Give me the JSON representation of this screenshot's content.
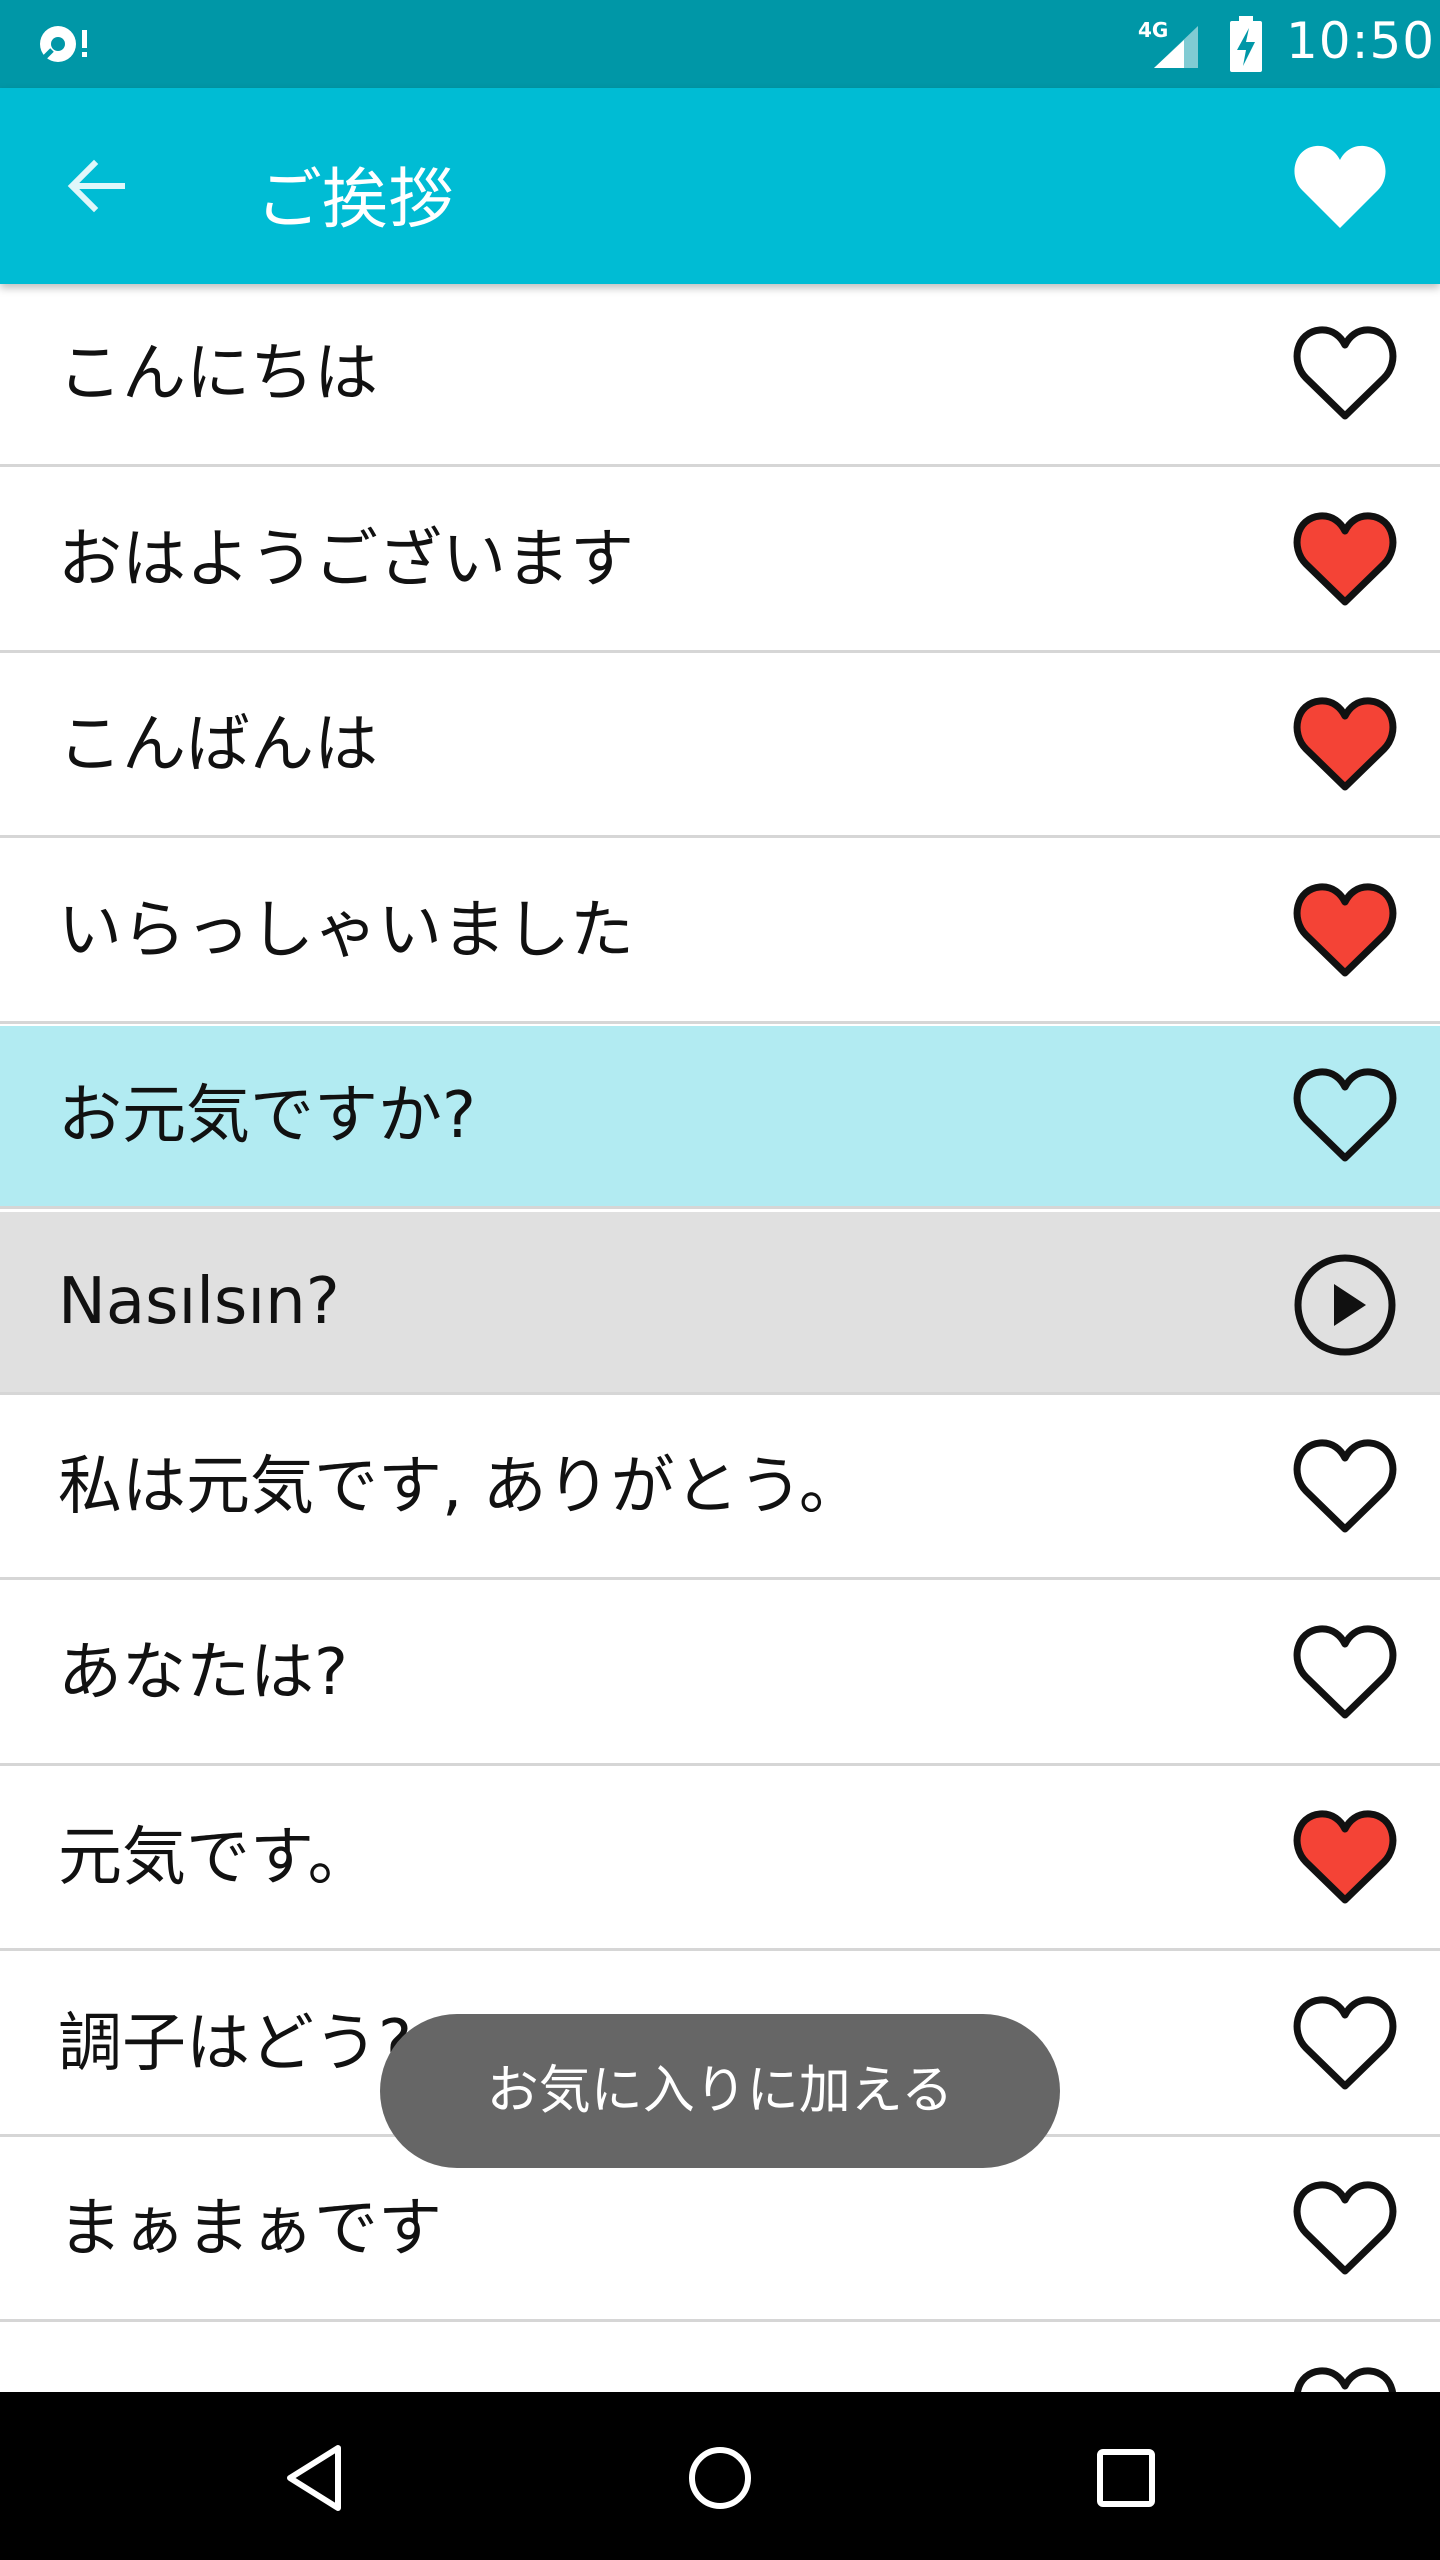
{
  "status_bar": {
    "network": "4G",
    "time": "10:50"
  },
  "app_bar": {
    "title": "ご挨拶",
    "back_icon": "arrow-back-icon",
    "favorite_icon": "heart-filled-icon"
  },
  "list": {
    "items": [
      {
        "text": "こんにちは",
        "favorite": false,
        "state": "normal"
      },
      {
        "text": "おはようございます",
        "favorite": true,
        "state": "normal"
      },
      {
        "text": "こんばんは",
        "favorite": true,
        "state": "normal"
      },
      {
        "text": "いらっしゃいました",
        "favorite": true,
        "state": "normal"
      },
      {
        "text": "お元気ですか?",
        "favorite": false,
        "state": "selected"
      },
      {
        "text": "Nasılsın?",
        "favorite": false,
        "state": "translation"
      },
      {
        "text": "私は元気です, ありがとう。",
        "favorite": false,
        "state": "normal"
      },
      {
        "text": "あなたは?",
        "favorite": false,
        "state": "normal"
      },
      {
        "text": "元気です。",
        "favorite": true,
        "state": "normal"
      },
      {
        "text": "調子はどう?",
        "favorite": false,
        "state": "normal"
      },
      {
        "text": "まぁまぁです",
        "favorite": false,
        "state": "normal"
      },
      {
        "text": "",
        "favorite": false,
        "state": "normal"
      }
    ]
  },
  "toast": {
    "message": "お気に入りに加える"
  },
  "colors": {
    "status_bar": "#0097a7",
    "app_bar": "#00bcd4",
    "selected_row": "#b2ebf2",
    "translation_row": "#e0e0e0",
    "heart_filled": "#f44336"
  }
}
